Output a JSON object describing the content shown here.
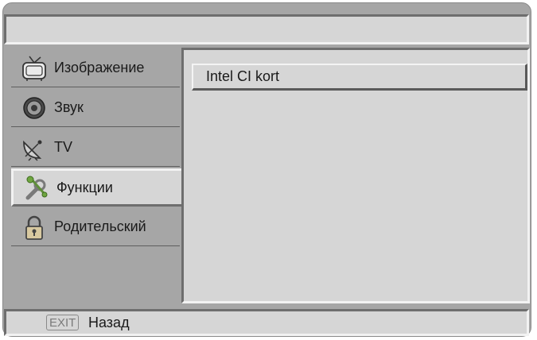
{
  "menu": {
    "items": [
      {
        "label": "Изображение",
        "icon": "tv-icon"
      },
      {
        "label": "Звук",
        "icon": "speaker-icon"
      },
      {
        "label": "TV",
        "icon": "satellite-dish-icon"
      },
      {
        "label": "Функции",
        "icon": "tools-icon",
        "selected": true
      },
      {
        "label": "Родительский",
        "icon": "lock-icon"
      }
    ]
  },
  "content": {
    "items": [
      {
        "label": "Intel CI kort"
      }
    ]
  },
  "footer": {
    "key": "EXIT",
    "label": "Назад"
  },
  "colors": {
    "frame": "#a6a6a6",
    "panel": "#d6d6d6",
    "text": "#1a1a1a"
  }
}
